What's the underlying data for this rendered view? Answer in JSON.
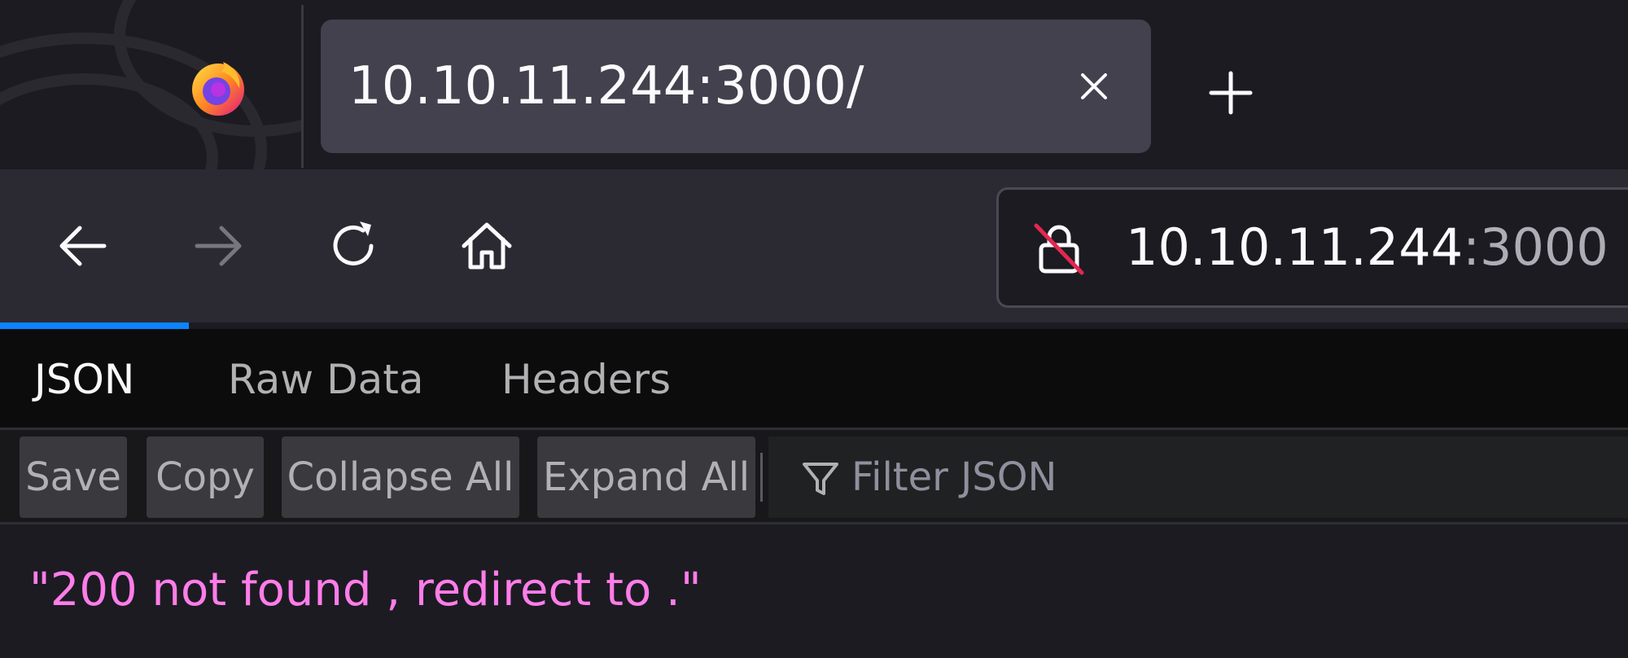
{
  "tab": {
    "title": "10.10.11.244:3000/",
    "close_icon": "close-icon"
  },
  "newtab": {
    "icon": "plus-icon"
  },
  "navbar": {
    "back_icon": "back-arrow-icon",
    "forward_icon": "forward-arrow-icon",
    "reload_icon": "reload-icon",
    "home_icon": "home-icon"
  },
  "urlbar": {
    "lock_icon": "insecure-lock-icon",
    "host": "10.10.11.244",
    "port": ":3000"
  },
  "viewer_tabs": [
    "JSON",
    "Raw Data",
    "Headers"
  ],
  "toolbar": {
    "save": "Save",
    "copy": "Copy",
    "collapse_all": "Collapse All",
    "expand_all": "Expand All",
    "filter_placeholder": "Filter JSON"
  },
  "content": {
    "value": "\"200 not found , redirect to .\""
  },
  "colors": {
    "accent": "#0a84ff",
    "json_string": "#ff7de9",
    "insecure_slash": "#e22850"
  }
}
